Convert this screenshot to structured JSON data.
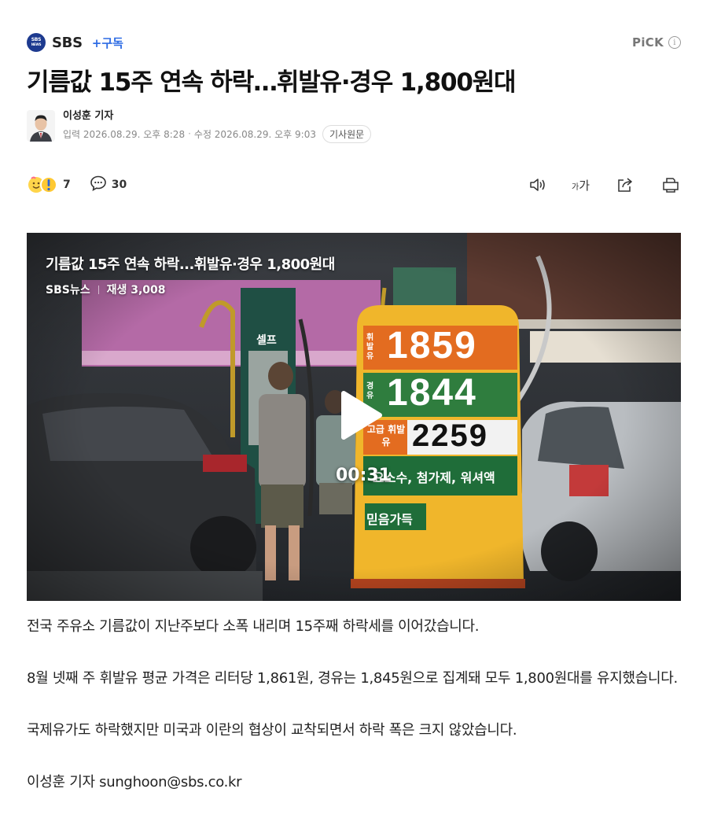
{
  "press": {
    "logo_text_top": "SBS",
    "logo_text_bottom": "NEWS",
    "name": "SBS",
    "subscribe_label": "+구독",
    "pick_label": "PiCK",
    "info_glyph": "i",
    "brand_color": "#1d3a8f",
    "subscribe_color": "#2e6ce4"
  },
  "article": {
    "headline": "기름값 15주 연속 하락…휘발유·경우 1,800원대",
    "reporter": "이성훈 기자",
    "published": "입력 2026.08.29. 오후 8:28",
    "modified": "수정 2026.08.29. 오후 9:03",
    "meta_separator": "·",
    "source_button": "기사원문"
  },
  "toolbar": {
    "reaction_count": "7",
    "comment_count": "30",
    "fontsize_small": "가",
    "fontsize_large": "가",
    "icons": [
      "reaction-icon",
      "comment-icon",
      "speaker-icon",
      "font-size-icon",
      "share-icon",
      "print-icon"
    ]
  },
  "video": {
    "title": "기름값 15주 연속 하락...휘발유·경우 1,800원대",
    "channel": "SBS뉴스",
    "views": "재생 3,008",
    "duration": "00:31",
    "sign": {
      "row1_label": "휘발유",
      "row1_price": "1859",
      "row2_label": "경유",
      "row2_price": "1844",
      "row3_label": "고급 휘발유",
      "row3_price": "2259",
      "banner": "요소수, 첨가제, 워셔액",
      "trust": "믿음가득",
      "self": "셀프"
    }
  },
  "body": {
    "p1": "전국 주유소 기름값이 지난주보다 소폭 내리며 15주째 하락세를 이어갔습니다.",
    "p2": "8월 넷째 주 휘발유 평균 가격은 리터당 1,861원, 경유는 1,845원으로 집계돼 모두 1,800원대를 유지했습니다.",
    "p3": "국제유가도 하락했지만 미국과 이란의 협상이 교착되면서 하락 폭은 크지 않았습니다.",
    "signature": "이성훈 기자 sunghoon@sbs.co.kr"
  }
}
